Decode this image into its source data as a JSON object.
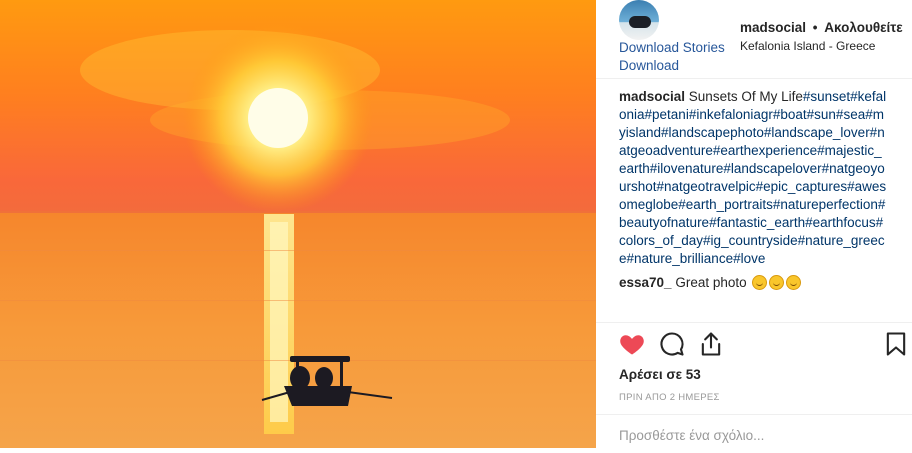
{
  "post": {
    "username": "madsocial",
    "follow_status": "Ακολουθείτε",
    "separator": "•",
    "location": "Kefalonia Island - Greece",
    "download_stories": "Download Stories",
    "download": "Download"
  },
  "caption": {
    "username": "madsocial",
    "text": "Sunsets Of My Life",
    "hashtags": "#sunset#kefalonia#petani#inkefaloniagr#boat#sun#sea#myisland#landscapephoto#landscape_lover#natgeoadventure#earthexperience#majestic_earth#ilovenature#landscapelover#natgeoyourshot#natgeotravelpic#epic_captures#awesomeglobe#earth_portraits#natureperfection#beautyofnature#fantastic_earth#earthfocus#colors_of_day#ig_countryside#nature_greece#nature_brilliance#love"
  },
  "comments": [
    {
      "username": "essa70_",
      "text": "Great photo",
      "emoji": [
        "smiling-face",
        "smiling-face",
        "smiling-face"
      ]
    }
  ],
  "likes": "Αρέσει σε 53",
  "time": "ΠΡΙΝ ΑΠΟ 2 ΗΜΕΡΕΣ",
  "add_comment_placeholder": "Προσθέστε ένα σχόλιο...",
  "icons": [
    "heart-icon",
    "comment-icon",
    "share-icon",
    "bookmark-icon"
  ],
  "colors": {
    "like_red": "#ed4956",
    "link_blue": "#27579a",
    "hashtag_blue": "#003569"
  }
}
